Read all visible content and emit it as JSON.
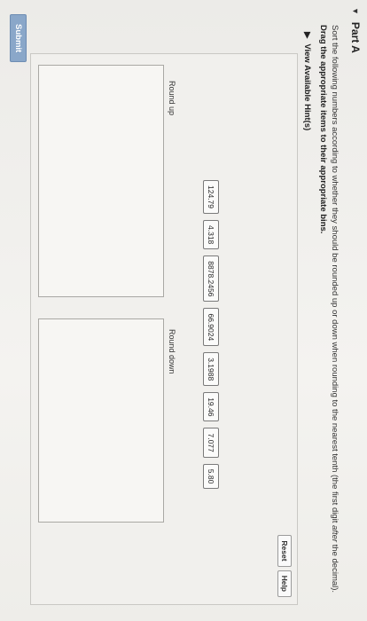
{
  "part": {
    "caret": "▼",
    "title": "Part A"
  },
  "instructions": {
    "text_before": "Sort the following numbers according to whether they should be rounded up or down when rounding to the nearest tenth (the first digit ",
    "text_italic": "after",
    "text_after": " the decimal).",
    "bold_line": "Drag the appropriate items to their appropriate bins."
  },
  "hints": {
    "caret": "▶",
    "label": "View Available Hint(s)"
  },
  "controls": {
    "reset_label": "Reset",
    "help_label": "Help"
  },
  "tiles": [
    "124.79",
    "4.318",
    "8878.2456",
    "66.9024",
    "3.1988",
    "19.46",
    "7.077",
    "5.80"
  ],
  "bins": {
    "round_up_label": "Round up",
    "round_down_label": "Round down"
  },
  "submit_label": "Submit"
}
